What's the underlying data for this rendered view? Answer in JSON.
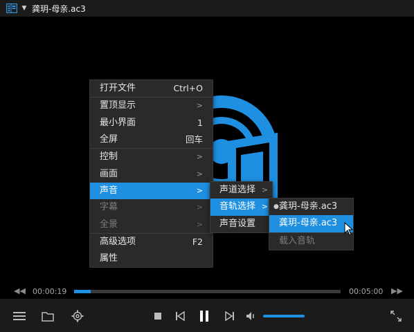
{
  "window": {
    "title": "龚玥-母亲.ac3"
  },
  "main_menu": {
    "open_file": {
      "label": "打开文件",
      "shortcut": "Ctrl+O"
    },
    "pin_top": {
      "label": "置顶显示"
    },
    "mini_ui": {
      "label": "最小界面",
      "shortcut": "1"
    },
    "fullscreen": {
      "label": "全屏",
      "shortcut": "回车"
    },
    "control": {
      "label": "控制"
    },
    "picture": {
      "label": "画面"
    },
    "audio": {
      "label": "声音"
    },
    "subtitle": {
      "label": "字幕"
    },
    "panorama": {
      "label": "全景"
    },
    "advanced": {
      "label": "高级选项",
      "shortcut": "F2"
    },
    "properties": {
      "label": "属性"
    }
  },
  "audio_menu": {
    "channel": {
      "label": "声道选择"
    },
    "track": {
      "label": "音轨选择"
    },
    "settings": {
      "label": "声音设置"
    }
  },
  "track_menu": {
    "items": [
      {
        "label": "龚玥-母亲.ac3"
      },
      {
        "label": "龚玥-母亲.ac3"
      }
    ],
    "load": {
      "label": "载入音轨"
    }
  },
  "seek": {
    "current": "00:00:19",
    "total": "00:05:00",
    "progress": 0.063
  },
  "volume": {
    "level": 1.0
  },
  "colors": {
    "accent": "#1e8fe1",
    "menu_bg": "#2a2a2a",
    "bar_bg": "#1b1b1b"
  },
  "icons": [
    "playlist-icon",
    "caret-down-icon",
    "rewind-icon",
    "forward-icon",
    "menu-icon",
    "folder-icon",
    "gear-icon",
    "stop-icon",
    "prev-icon",
    "pause-icon",
    "next-icon",
    "volume-icon",
    "expand-icon",
    "cursor-icon"
  ]
}
